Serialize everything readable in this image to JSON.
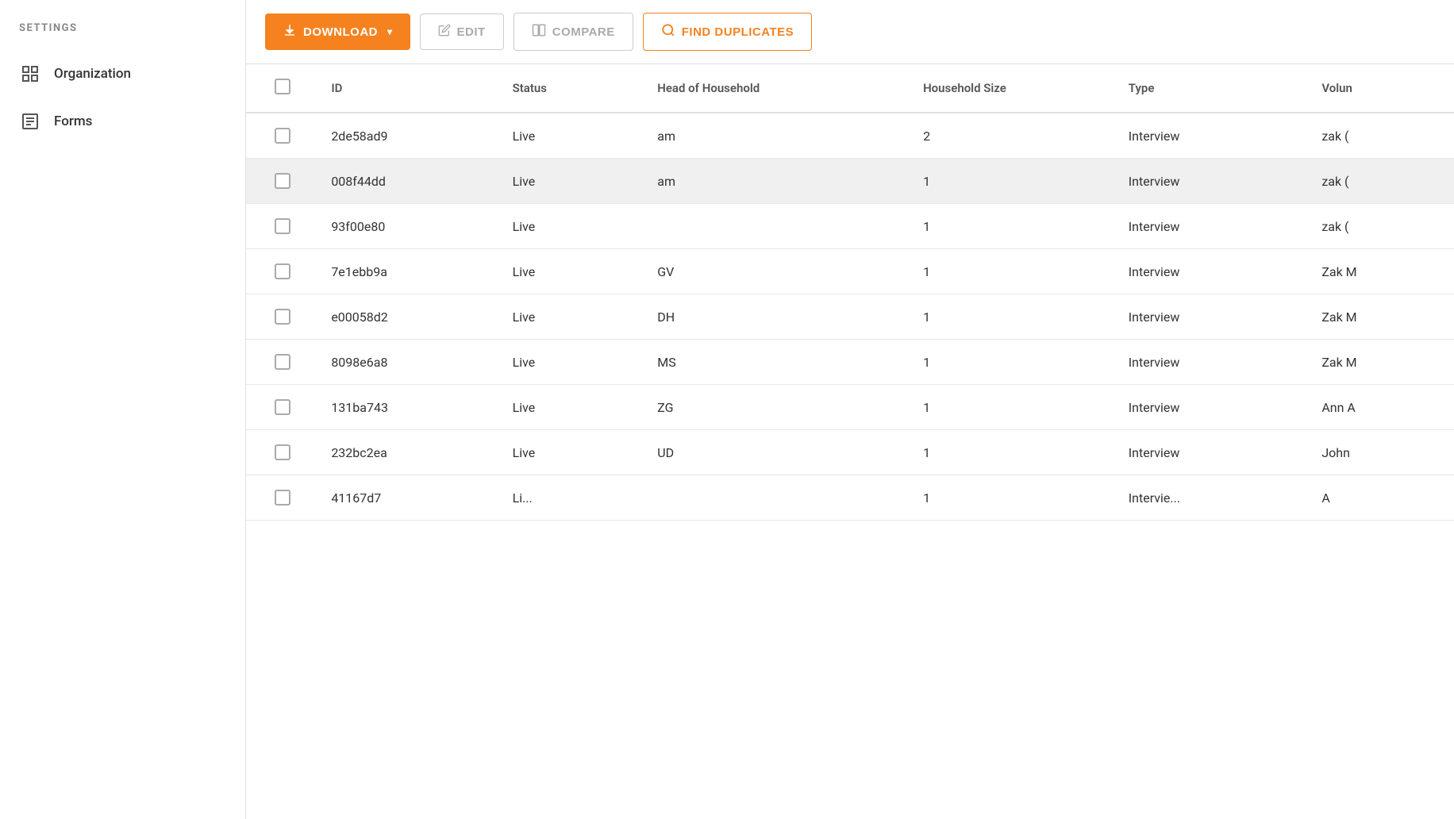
{
  "sidebar": {
    "settings_label": "SETTINGS",
    "items": [
      {
        "id": "organization",
        "label": "Organization",
        "icon": "grid"
      },
      {
        "id": "forms",
        "label": "Forms",
        "icon": "list"
      }
    ]
  },
  "toolbar": {
    "download_label": "DOWNLOAD",
    "edit_label": "EDIT",
    "compare_label": "COMPARE",
    "find_duplicates_label": "FIND DUPLICATES"
  },
  "table": {
    "columns": [
      "ID",
      "Status",
      "Head of Household",
      "Household Size",
      "Type",
      "Volun"
    ],
    "rows": [
      {
        "id": "2de58ad9",
        "status": "Live",
        "head_of_household": "am",
        "household_size": "2",
        "type": "Interview",
        "volume": "zak (",
        "highlighted": false
      },
      {
        "id": "008f44dd",
        "status": "Live",
        "head_of_household": "am",
        "household_size": "1",
        "type": "Interview",
        "volume": "zak (",
        "highlighted": true
      },
      {
        "id": "93f00e80",
        "status": "Live",
        "head_of_household": "",
        "household_size": "1",
        "type": "Interview",
        "volume": "zak (",
        "highlighted": false
      },
      {
        "id": "7e1ebb9a",
        "status": "Live",
        "head_of_household": "GV",
        "household_size": "1",
        "type": "Interview",
        "volume": "Zak M",
        "highlighted": false
      },
      {
        "id": "e00058d2",
        "status": "Live",
        "head_of_household": "DH",
        "household_size": "1",
        "type": "Interview",
        "volume": "Zak M",
        "highlighted": false
      },
      {
        "id": "8098e6a8",
        "status": "Live",
        "head_of_household": "MS",
        "household_size": "1",
        "type": "Interview",
        "volume": "Zak M",
        "highlighted": false
      },
      {
        "id": "131ba743",
        "status": "Live",
        "head_of_household": "ZG",
        "household_size": "1",
        "type": "Interview",
        "volume": "Ann A",
        "highlighted": false
      },
      {
        "id": "232bc2ea",
        "status": "Live",
        "head_of_household": "UD",
        "household_size": "1",
        "type": "Interview",
        "volume": "John",
        "highlighted": false
      },
      {
        "id": "41167d7",
        "status": "Li...",
        "head_of_household": "",
        "household_size": "1",
        "type": "Intervie...",
        "volume": "A",
        "highlighted": false
      }
    ]
  },
  "colors": {
    "orange": "#f5821f",
    "disabled_border": "#cccccc",
    "disabled_text": "#aaaaaa"
  }
}
